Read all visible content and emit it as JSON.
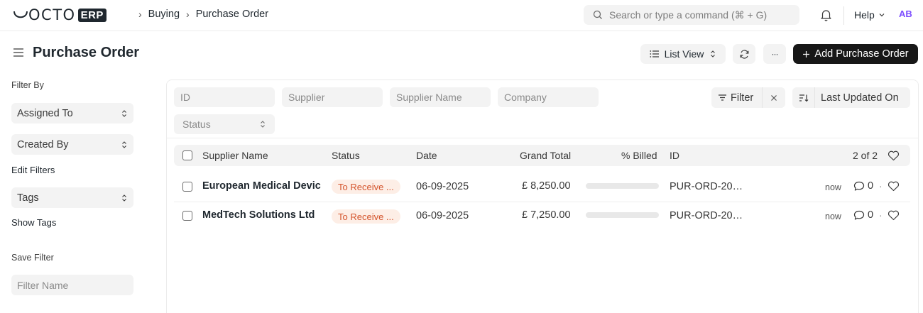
{
  "navbar": {
    "logo_text": "OCTO",
    "logo_badge": "ERP",
    "breadcrumbs": [
      "Buying",
      "Purchase Order"
    ],
    "search_placeholder": "Search or type a command (⌘ + G)",
    "help_label": "Help",
    "avatar_initials": "AB"
  },
  "header": {
    "title": "Purchase Order",
    "list_view_label": "List View",
    "more_label": "···",
    "add_button_label": "Add Purchase Order"
  },
  "sidebar": {
    "filter_by_label": "Filter By",
    "assigned_to": "Assigned To",
    "created_by": "Created By",
    "edit_filters": "Edit Filters",
    "tags": "Tags",
    "show_tags": "Show Tags",
    "save_filter_label": "Save Filter",
    "filter_name_placeholder": "Filter Name"
  },
  "filters": {
    "id_placeholder": "ID",
    "supplier_placeholder": "Supplier",
    "supplier_name_placeholder": "Supplier Name",
    "company_placeholder": "Company",
    "status_placeholder": "Status",
    "filter_label": "Filter",
    "sort_label": "Last Updated On"
  },
  "table": {
    "columns": [
      "Supplier Name",
      "Status",
      "Date",
      "Grand Total",
      "% Billed",
      "ID"
    ],
    "count_label": "2 of 2",
    "rows": [
      {
        "supplier": "European Medical Devic",
        "status": "To Receive ...",
        "date": "06-09-2025",
        "grand_total": "£ 8,250.00",
        "billed_percent": 0,
        "id": "PUR-ORD-20…",
        "modified": "now",
        "comments": "0"
      },
      {
        "supplier": "MedTech Solutions Ltd",
        "status": "To Receive ...",
        "date": "06-09-2025",
        "grand_total": "£ 7,250.00",
        "billed_percent": 0,
        "id": "PUR-ORD-20…",
        "modified": "now",
        "comments": "0"
      }
    ]
  },
  "colors": {
    "primary_button": "#171717",
    "status_pill_bg": "#fdeee6",
    "status_pill_text": "#d4542c",
    "avatar": "#7c4dff"
  }
}
